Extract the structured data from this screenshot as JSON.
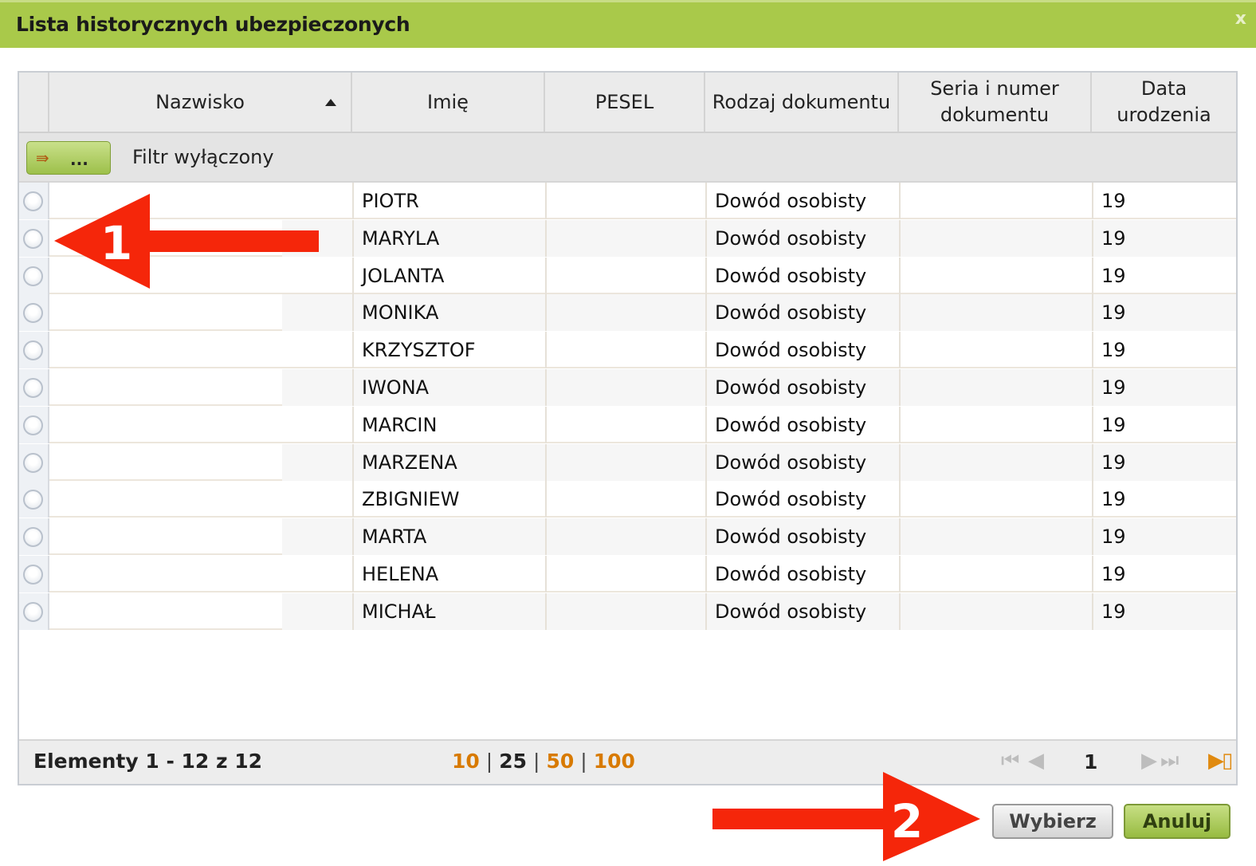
{
  "dialog": {
    "title": "Lista historycznych ubezpieczonych",
    "close_symbol": "x"
  },
  "grid": {
    "columns": [
      {
        "label": "Nazwisko"
      },
      {
        "label": "Imię"
      },
      {
        "label": "PESEL"
      },
      {
        "label": "Rodzaj dokumentu"
      },
      {
        "label": "Seria i numer dokumentu"
      },
      {
        "label": "Data urodzenia"
      }
    ],
    "filter": {
      "button_label": "...",
      "status": "Filtr wyłączony"
    },
    "rows": [
      {
        "first_name": "PIOTR",
        "doc_type": "Dowód osobisty",
        "birth": "19"
      },
      {
        "first_name": "MARYLA",
        "doc_type": "Dowód osobisty",
        "birth": "19"
      },
      {
        "first_name": "JOLANTA",
        "doc_type": "Dowód osobisty",
        "birth": "19"
      },
      {
        "first_name": "MONIKA",
        "doc_type": "Dowód osobisty",
        "birth": "19"
      },
      {
        "first_name": "KRZYSZTOF",
        "doc_type": "Dowód osobisty",
        "birth": "19"
      },
      {
        "first_name": "IWONA",
        "doc_type": "Dowód osobisty",
        "birth": "19"
      },
      {
        "first_name": "MARCIN",
        "doc_type": "Dowód osobisty",
        "birth": "19"
      },
      {
        "first_name": "MARZENA",
        "doc_type": "Dowód osobisty",
        "birth": "19"
      },
      {
        "first_name": "ZBIGNIEW",
        "doc_type": "Dowód osobisty",
        "birth": "19"
      },
      {
        "first_name": "MARTA",
        "doc_type": "Dowód osobisty",
        "birth": "19"
      },
      {
        "first_name": "HELENA",
        "doc_type": "Dowód osobisty",
        "birth": "19"
      },
      {
        "first_name": "MICHAŁ",
        "doc_type": "Dowód osobisty",
        "birth": "19"
      }
    ]
  },
  "pager": {
    "summary": "Elementy 1 - 12 z 12",
    "page_sizes": [
      "10",
      "25",
      "50",
      "100"
    ],
    "active_page_size": "25",
    "current_page": "1"
  },
  "actions": {
    "select_label": "Wybierz",
    "cancel_label": "Anuluj"
  },
  "annotations": {
    "arrow1_label": "1",
    "arrow2_label": "2",
    "arrow_color": "#f5260a"
  }
}
